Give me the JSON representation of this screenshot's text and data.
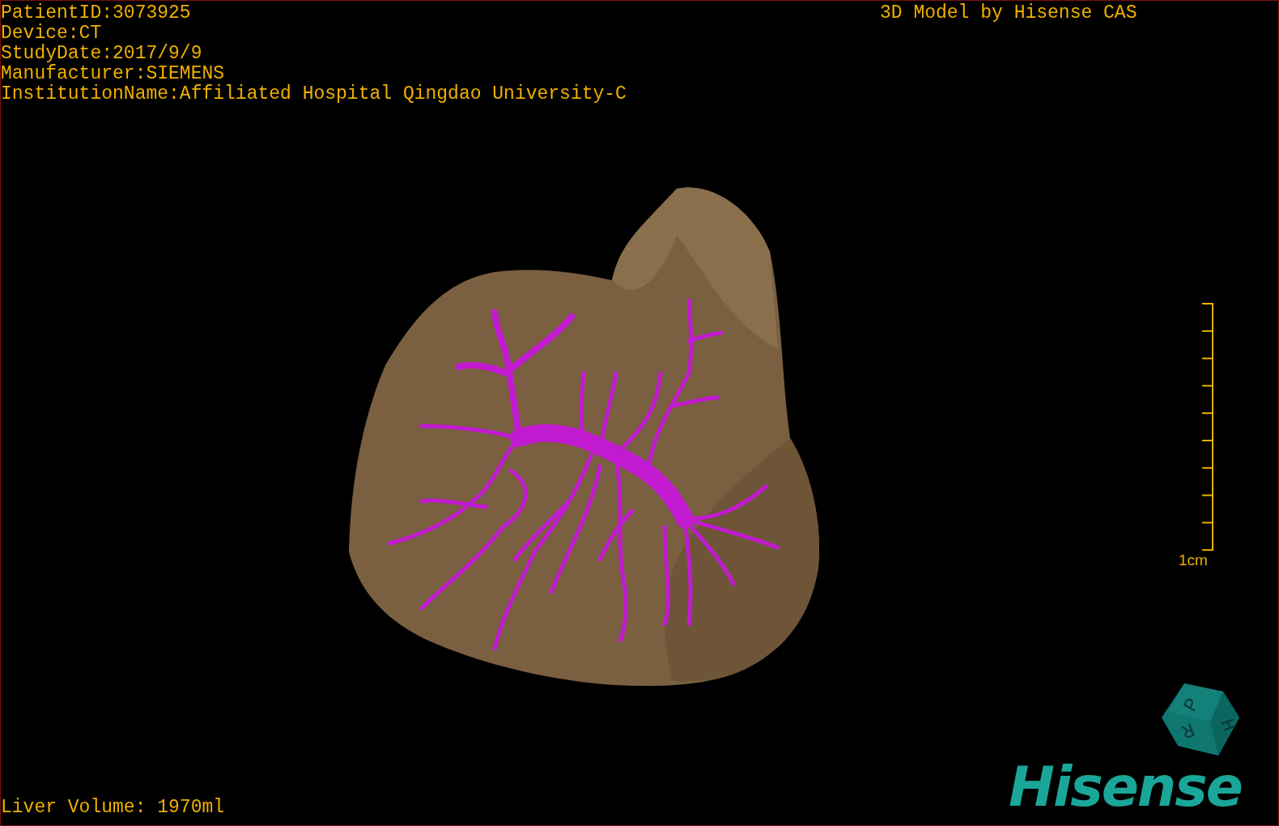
{
  "patient_info": [
    "PatientID:3073925",
    "Device:CT",
    "StudyDate:2017/9/9",
    "Manufacturer:SIEMENS",
    "InstitutionName:Affiliated Hospital Qingdao University-C"
  ],
  "model_credit": "3D Model by Hisense CAS",
  "scale_bar": {
    "label": "1cm"
  },
  "liver_volume": "Liver Volume: 1970ml",
  "orientation_cube": {
    "faces": [
      "P",
      "H",
      "R"
    ]
  },
  "logo": "Hisense"
}
